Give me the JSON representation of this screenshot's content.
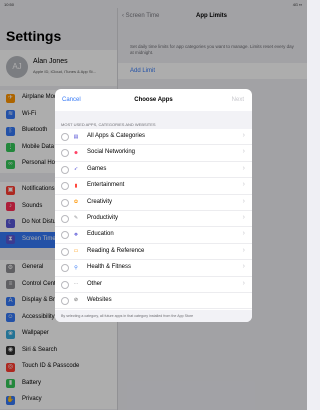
{
  "status": {
    "time": "10:50",
    "right": "4G ▪▪"
  },
  "sidebar": {
    "title": "Settings",
    "profile": {
      "initials": "AJ",
      "name": "Alan Jones",
      "subtitle": "Apple ID, iCloud, iTunes & App St..."
    },
    "groups": [
      [
        {
          "label": "Airplane Mode",
          "icon": "airplane-icon",
          "color": "#ff9500",
          "glyph": "✈"
        },
        {
          "label": "Wi-Fi",
          "icon": "wifi-icon",
          "color": "#3478f6",
          "glyph": "≋"
        },
        {
          "label": "Bluetooth",
          "icon": "bluetooth-icon",
          "color": "#3478f6",
          "glyph": "ᛒ"
        },
        {
          "label": "Mobile Data",
          "icon": "antenna-icon",
          "color": "#34c759",
          "glyph": "⋮"
        },
        {
          "label": "Personal Hotspot",
          "icon": "hotspot-icon",
          "color": "#34c759",
          "glyph": "∞"
        }
      ],
      [
        {
          "label": "Notifications",
          "icon": "notifications-icon",
          "color": "#ff3b30",
          "glyph": "▣"
        },
        {
          "label": "Sounds",
          "icon": "sounds-icon",
          "color": "#ff2d55",
          "glyph": "♪"
        },
        {
          "label": "Do Not Disturb",
          "icon": "moon-icon",
          "color": "#5856d6",
          "glyph": "☾"
        },
        {
          "label": "Screen Time",
          "icon": "hourglass-icon",
          "color": "#5856d6",
          "glyph": "⧗",
          "selected": true
        }
      ],
      [
        {
          "label": "General",
          "icon": "gear-icon",
          "color": "#8e8e93",
          "glyph": "⚙"
        },
        {
          "label": "Control Centre",
          "icon": "control-centre-icon",
          "color": "#8e8e93",
          "glyph": "≡"
        },
        {
          "label": "Display & Brightness",
          "icon": "display-icon",
          "color": "#3478f6",
          "glyph": "A"
        },
        {
          "label": "Accessibility",
          "icon": "accessibility-icon",
          "color": "#3478f6",
          "glyph": "☺"
        },
        {
          "label": "Wallpaper",
          "icon": "wallpaper-icon",
          "color": "#34aadc",
          "glyph": "❀"
        },
        {
          "label": "Siri & Search",
          "icon": "siri-icon",
          "color": "#333333",
          "glyph": "◉"
        },
        {
          "label": "Touch ID & Passcode",
          "icon": "fingerprint-icon",
          "color": "#ff3b30",
          "glyph": "◎"
        },
        {
          "label": "Battery",
          "icon": "battery-icon",
          "color": "#34c759",
          "glyph": "▮"
        },
        {
          "label": "Privacy",
          "icon": "hand-icon",
          "color": "#3478f6",
          "glyph": "✋"
        }
      ]
    ]
  },
  "detail": {
    "back_label": "‹ Screen Time",
    "title": "App Limits",
    "description": "Set daily time limits for app categories you want to manage. Limits reset every day at midnight.",
    "add_limit": "Add Limit"
  },
  "modal": {
    "cancel": "Cancel",
    "title": "Choose Apps",
    "next": "Next",
    "section_header": "MOST USED APPS, CATEGORIES AND WEBSITES",
    "items": [
      {
        "label": "All Apps & Categories",
        "icon": "stack-icon",
        "color": "#5856d6",
        "glyph": "▤"
      },
      {
        "label": "Social Networking",
        "icon": "social-icon",
        "color": "#ff2d55",
        "glyph": "☻"
      },
      {
        "label": "Games",
        "icon": "rocket-icon",
        "color": "#5856d6",
        "glyph": "➶"
      },
      {
        "label": "Entertainment",
        "icon": "entertainment-icon",
        "color": "#ff3b30",
        "glyph": "▮"
      },
      {
        "label": "Creativity",
        "icon": "palette-icon",
        "color": "#ff9500",
        "glyph": "✿"
      },
      {
        "label": "Productivity",
        "icon": "pencil-icon",
        "color": "#8e8e93",
        "glyph": "✎"
      },
      {
        "label": "Education",
        "icon": "education-icon",
        "color": "#5856d6",
        "glyph": "❖"
      },
      {
        "label": "Reading & Reference",
        "icon": "book-icon",
        "color": "#ff9500",
        "glyph": "▭"
      },
      {
        "label": "Health & Fitness",
        "icon": "bicycle-icon",
        "color": "#3478f6",
        "glyph": "⚲"
      },
      {
        "label": "Other",
        "icon": "more-icon",
        "color": "#8e8e93",
        "glyph": "···"
      },
      {
        "label": "Websites",
        "icon": "compass-icon",
        "color": "#555555",
        "glyph": "⊘",
        "no_chevron": true
      }
    ],
    "footer": "By selecting a category, all future apps in that category installed from the App Store"
  }
}
